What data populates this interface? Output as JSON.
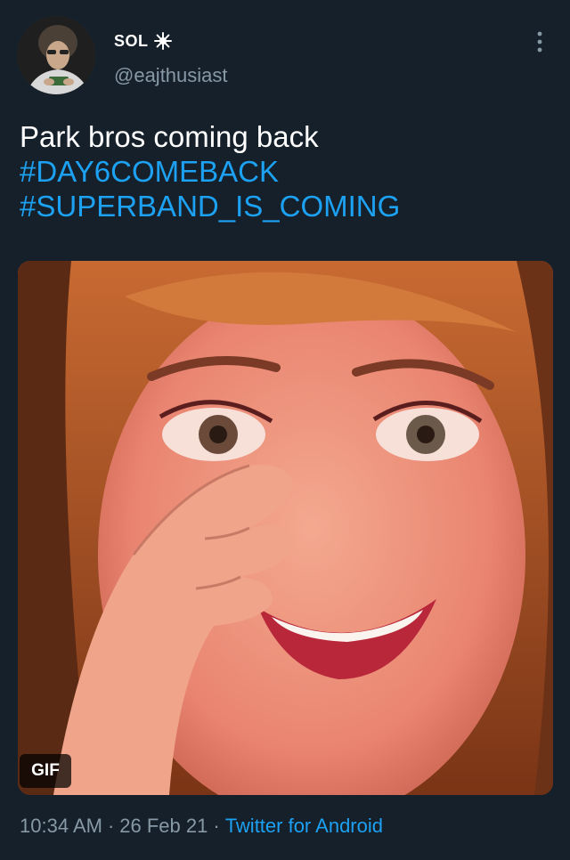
{
  "user": {
    "display_name": "SOL",
    "badge_icon": "sun-icon",
    "handle": "@eajthusiast"
  },
  "tweet": {
    "text": "Park bros coming back",
    "hashtags": [
      "#DAY6COMEBACK",
      "#SUPERBAND_IS_COMING"
    ]
  },
  "media": {
    "badge": "GIF",
    "type": "gif"
  },
  "meta": {
    "time": "10:34 AM",
    "date": "26 Feb 21",
    "separator": "·",
    "source": "Twitter for Android"
  },
  "colors": {
    "background": "#15202b",
    "link": "#1da1f2",
    "secondary_text": "#8899a6",
    "primary_text": "#ffffff"
  },
  "menu": {
    "icon": "more-vertical-icon"
  }
}
